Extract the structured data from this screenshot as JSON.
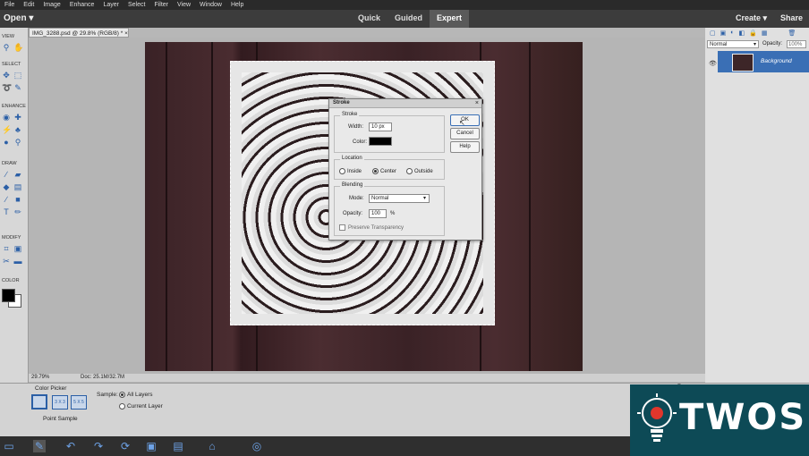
{
  "menubar": {
    "items": [
      "File",
      "Edit",
      "Image",
      "Enhance",
      "Layer",
      "Select",
      "Filter",
      "View",
      "Window",
      "Help"
    ]
  },
  "modebar": {
    "open_label": "Open",
    "tabs": [
      {
        "label": "Quick",
        "active": false
      },
      {
        "label": "Guided",
        "active": false
      },
      {
        "label": "Expert",
        "active": true
      }
    ],
    "create_label": "Create",
    "share_label": "Share"
  },
  "toolbox": {
    "sections": [
      "VIEW",
      "SELECT",
      "ENHANCE",
      "DRAW",
      "MODIFY",
      "COLOR"
    ]
  },
  "document": {
    "tab_label": "IMG_3288.psd @ 29.8% (RGB/8) *"
  },
  "dialog": {
    "title": "Stroke",
    "stroke_group": "Stroke",
    "width_label": "Width:",
    "width_value": "10 px",
    "color_label": "Color:",
    "color_value": "#000000",
    "location_group": "Location",
    "location_options": [
      "Inside",
      "Center",
      "Outside"
    ],
    "location_selected": "Center",
    "blending_group": "Blending",
    "mode_label": "Mode:",
    "mode_value": "Normal",
    "opacity_label": "Opacity:",
    "opacity_value": "100",
    "opacity_unit": "%",
    "preserve_label": "Preserve Transparency",
    "buttons": {
      "ok": "OK",
      "cancel": "Cancel",
      "help": "Help"
    }
  },
  "statusbar": {
    "zoom": "29.79%",
    "doc": "Doc: 25.1M/32.7M"
  },
  "layers": {
    "blend_mode": "Normal",
    "opacity_label": "Opacity:",
    "opacity_value": "100%",
    "layer_name": "Background"
  },
  "options": {
    "tool_name": "Color Picker",
    "sample_sizes": [
      "3 X 3",
      "5 X 5"
    ],
    "point_sample_label": "Point Sample",
    "sample_label": "Sample:",
    "sample_options": [
      "All Layers",
      "Current Layer"
    ],
    "sample_selected": "All Layers"
  },
  "watermark": {
    "text": "TWOS"
  }
}
